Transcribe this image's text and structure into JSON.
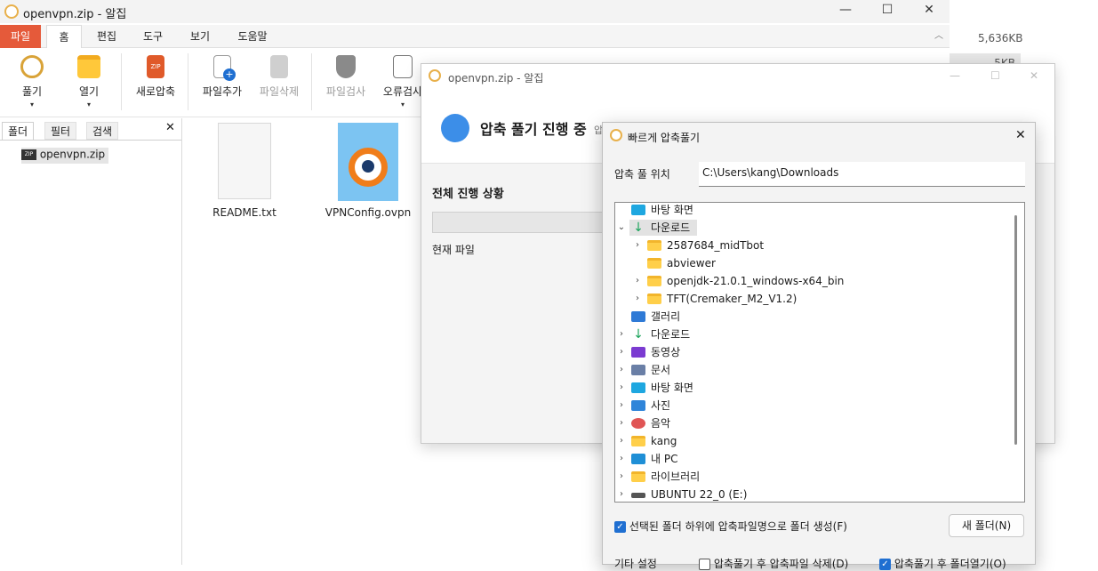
{
  "main_window": {
    "title": "openvpn.zip - 알집",
    "controls": {
      "minimize": "—",
      "maximize": "☐",
      "close": "✕"
    }
  },
  "ribbon": {
    "tabs": [
      "파일",
      "홈",
      "편집",
      "도구",
      "보기",
      "도움말"
    ],
    "buttons": {
      "extract": "풀기",
      "open": "열기",
      "new_compress": "새로압축",
      "add_file": "파일추가",
      "delete_file": "파일삭제",
      "scan_file": "파일검사",
      "error_check": "오류검사"
    }
  },
  "left_pane": {
    "tabs": [
      "폴더",
      "필터",
      "검색"
    ],
    "close": "✕",
    "tree_item": "openvpn.zip",
    "zip_badge": "ZIP"
  },
  "files": [
    {
      "name": "README.txt"
    },
    {
      "name": "VPNConfig.ovpn"
    }
  ],
  "right_strip": {
    "size1": "5,636KB",
    "size2": "5KB"
  },
  "progress_dialog": {
    "title": "openvpn.zip - 알집",
    "heading": "압축 풀기 진행 중",
    "heading_tail": "압",
    "overall_label": "전체 진행 상황",
    "current_file_label": "현재 파일",
    "overall_progress": 0
  },
  "quick_extract": {
    "title": "빠르게 압축풀기",
    "close": "✕",
    "location_label": "압축 풀 위치",
    "location_value": "C:\\Users\\kang\\Downloads",
    "tree": [
      {
        "label": "바탕 화면",
        "level": 0,
        "chevron": "",
        "icon": "desktop"
      },
      {
        "label": "다운로드",
        "level": 0,
        "chevron": "⌄",
        "icon": "download",
        "selected": true
      },
      {
        "label": "2587684_midTbot",
        "level": 1,
        "chevron": "›",
        "icon": "folder"
      },
      {
        "label": "abviewer",
        "level": 1,
        "chevron": "",
        "icon": "folder"
      },
      {
        "label": "openjdk-21.0.1_windows-x64_bin",
        "level": 1,
        "chevron": "›",
        "icon": "folder"
      },
      {
        "label": "TFT(Cremaker_M2_V1.2)",
        "level": 1,
        "chevron": "›",
        "icon": "folder"
      },
      {
        "label": "갤러리",
        "level": 0,
        "chevron": "",
        "icon": "gallery"
      },
      {
        "label": "다운로드",
        "level": 0,
        "chevron": "›",
        "icon": "download"
      },
      {
        "label": "동영상",
        "level": 0,
        "chevron": "›",
        "icon": "video"
      },
      {
        "label": "문서",
        "level": 0,
        "chevron": "›",
        "icon": "document"
      },
      {
        "label": "바탕 화면",
        "level": 0,
        "chevron": "›",
        "icon": "desktop"
      },
      {
        "label": "사진",
        "level": 0,
        "chevron": "›",
        "icon": "picture"
      },
      {
        "label": "음악",
        "level": 0,
        "chevron": "›",
        "icon": "music"
      },
      {
        "label": "kang",
        "level": 0,
        "chevron": "›",
        "icon": "folder"
      },
      {
        "label": "내 PC",
        "level": 0,
        "chevron": "›",
        "icon": "pc"
      },
      {
        "label": "라이브러리",
        "level": 0,
        "chevron": "›",
        "icon": "folder"
      },
      {
        "label": "UBUNTU 22_0 (E:)",
        "level": 0,
        "chevron": "›",
        "icon": "drive"
      }
    ],
    "create_subfolder_label": "선택된 폴더 하위에 압축파일명으로 폴더 생성(F)",
    "create_subfolder_checked": true,
    "new_folder_button": "새 폴더(N)",
    "other_settings_label": "기타 설정",
    "delete_after_label": "압축풀기 후 압축파일 삭제(D)",
    "delete_after_checked": false,
    "open_after_label": "압축풀기 후 폴더열기(O)",
    "open_after_checked": true
  },
  "colors": {
    "file_tab": "#e55a3a",
    "accent": "#1f6fd1"
  }
}
